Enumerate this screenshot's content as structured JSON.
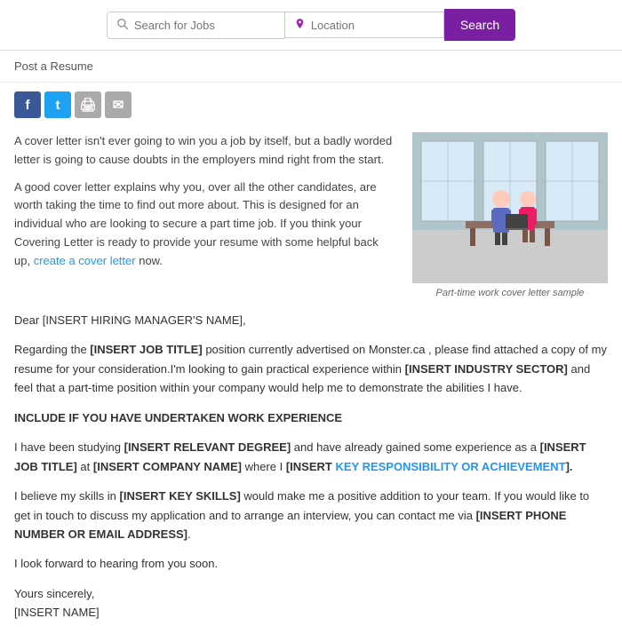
{
  "header": {
    "search_jobs_placeholder": "Search for Jobs",
    "location_placeholder": "Location",
    "search_button_label": "Search"
  },
  "post_resume": {
    "label": "Post a Resume"
  },
  "social": {
    "facebook_label": "f",
    "twitter_label": "t",
    "print_label": "🖨",
    "email_label": "✉"
  },
  "intro_paragraphs": {
    "p1": "A cover letter isn't ever going to win you a job by itself, but a badly worded letter is going to cause doubts in the employers mind right from the start.",
    "p2_start": "A good cover letter explains why you, over all the other candidates, are worth taking the time to find out more about. This is designed for an individual who are looking to secure a part time job. If you think your Covering Letter is ready to provide your resume with some helpful back up,",
    "p2_link": "create a cover letter",
    "p2_end": "now."
  },
  "image_caption": "Part-time work cover letter sample",
  "letter": {
    "salutation": "Dear [INSERT HIRING MANAGER'S NAME],",
    "para1_start": "Regarding the",
    "para1_job_title": "[INSERT JOB TITLE]",
    "para1_mid": "position currently advertised on Monster.ca , please find attached a copy of my resume for your consideration.I'm looking to gain practical experience within",
    "para1_sector": "[INSERT INDUSTRY SECTOR]",
    "para1_end": "and feel that a part-time position within your company would help me to demonstrate the abilities I have.",
    "section_heading": "INCLUDE IF YOU HAVE UNDERTAKEN WORK EXPERIENCE",
    "para2_start": "I have been studying",
    "para2_degree": "[INSERT RELEVANT DEGREE]",
    "para2_mid": "and have already gained some experience as a",
    "para2_job": "[INSERT JOB TITLE]",
    "para2_at": "at",
    "para2_company": "[INSERT COMPANY NAME]",
    "para2_where": "where I",
    "para2_insert": "[INSERT",
    "para2_key": "KEY RESPONSIBILITY OR ACHIEVEMENT",
    "para2_end": "].",
    "para3_start": "I believe my skills in",
    "para3_skills": "[INSERT KEY SKILLS]",
    "para3_mid": "would make me a positive addition to your team. If you would like to get in touch to discuss my application and to arrange an interview, you can contact me via",
    "para3_contact": "[INSERT PHONE NUMBER OR EMAIL ADDRESS]",
    "para3_end": ".",
    "closing1": "I look forward to hearing from you soon.",
    "closing2": "Yours sincerely,",
    "name": "[INSERT NAME]"
  }
}
